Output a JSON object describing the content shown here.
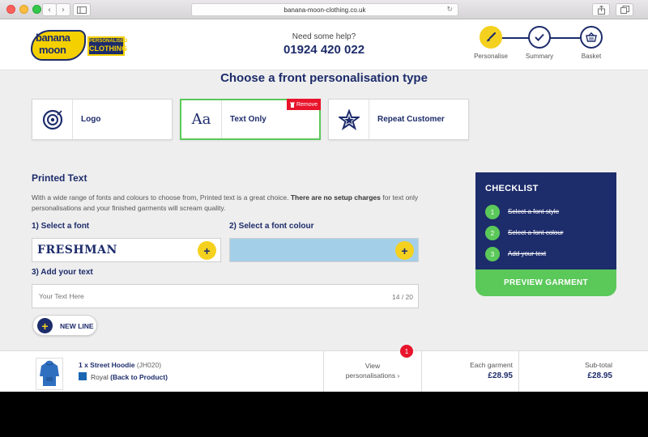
{
  "browser": {
    "url": "banana-moon-clothing.co.uk"
  },
  "header": {
    "logo": {
      "word1": "banana",
      "word2": "moon",
      "sub1": "PERSONALISED",
      "sub2": "CLOTHING"
    },
    "help_label": "Need some help?",
    "help_phone": "01924 420 022",
    "steps": [
      {
        "label": "Personalise",
        "icon": "paintbrush-icon",
        "active": true
      },
      {
        "label": "Summary",
        "icon": "check-icon",
        "active": false
      },
      {
        "label": "Basket",
        "icon": "basket-icon",
        "active": false
      }
    ]
  },
  "main": {
    "title": "Choose a front personalisation type",
    "types": [
      {
        "label": "Logo",
        "icon": "target-icon"
      },
      {
        "label": "Text Only",
        "icon": "aa-icon",
        "glyph": "Aa",
        "selected": true
      },
      {
        "label": "Repeat Customer",
        "icon": "star-icon"
      }
    ],
    "remove_label": "Remove",
    "section_title": "Printed Text",
    "desc_plain": "With a wide range of fonts and colours to choose from, Printed text is a great choice. ",
    "desc_bold": "There are no setup charges",
    "desc_end": " for text only personalisations and your finished garments will scream quality.",
    "select_font_label": "1) Select a font",
    "font_name": "Freshman",
    "select_colour_label": "2) Select a font colour",
    "colour_value": "#a4cfe9",
    "add_text_label": "3) Add your text",
    "text_placeholder": "Your Text Here",
    "char_count": "14 / 20",
    "plus_glyph": "+",
    "new_line_label": "NEW LINE"
  },
  "checklist": {
    "title": "CHECKLIST",
    "items": [
      {
        "num": "1",
        "label": "Select a font style"
      },
      {
        "num": "2",
        "label": "Select a font colour"
      },
      {
        "num": "3",
        "label": "Add your text"
      }
    ],
    "preview_label": "PREVIEW GARMENT"
  },
  "footer": {
    "qty_name": "1 x Street Hoodie",
    "code": "(JH020)",
    "colour": "Royal",
    "back_link": "(Back to Product)",
    "view_line1": "View",
    "view_line2": "personalisations ›",
    "badge_count": "1",
    "each_label": "Each garment",
    "each_price": "£28.95",
    "subtotal_label": "Sub-total",
    "subtotal_price": "£28.95"
  },
  "colors": {
    "navy": "#1d2c6b",
    "yellow": "#f5d11f",
    "green": "#5bc85a",
    "red": "#e8142c"
  }
}
